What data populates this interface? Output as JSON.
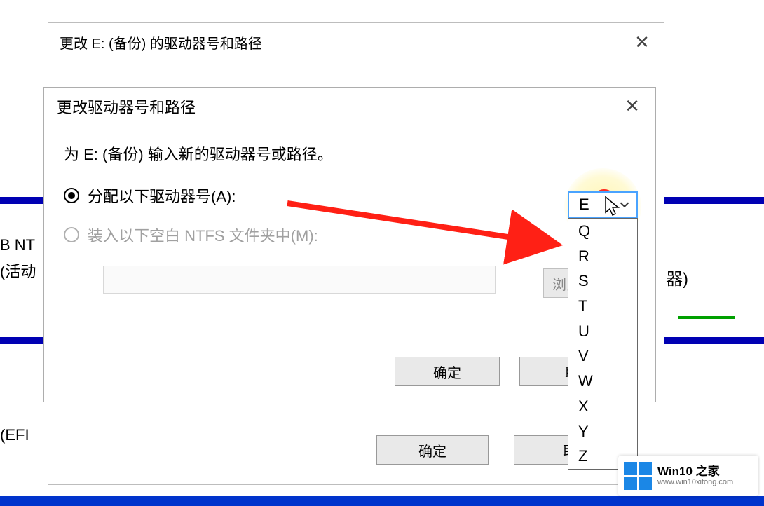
{
  "background": {
    "ntfs_label": "B NT",
    "active_label": "(活动",
    "efi_label": "(EFI ",
    "qi_label": "器)"
  },
  "outer_dialog": {
    "title": "更改 E: (备份) 的驱动器号和路径",
    "ok": "确定",
    "cancel": "取"
  },
  "inner_dialog": {
    "title": "更改驱动器号和路径",
    "instruction": "为 E: (备份) 输入新的驱动器号或路径。",
    "radio_assign": "分配以下驱动器号(A):",
    "radio_mount": "装入以下空白 NTFS 文件夹中(M):",
    "browse": "浏览",
    "ok": "确定",
    "cancel": "取"
  },
  "combo": {
    "selected": "E",
    "options": [
      "Q",
      "R",
      "S",
      "T",
      "U",
      "V",
      "W",
      "X",
      "Y",
      "Z"
    ]
  },
  "watermark": {
    "title": "Win10 之家",
    "sub": "www.win10xitong.com"
  }
}
